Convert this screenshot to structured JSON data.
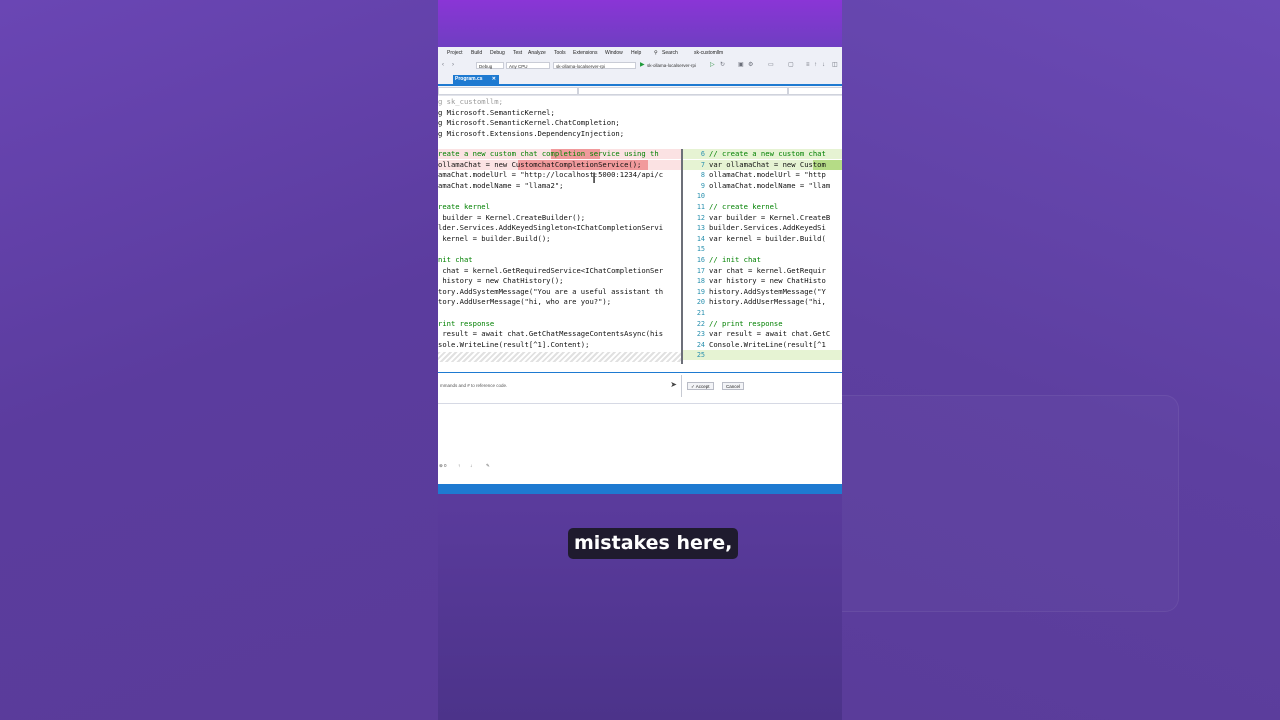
{
  "menu": [
    "Project",
    "Build",
    "Debug",
    "Test",
    "Analyze",
    "Tools",
    "Extensions",
    "Window",
    "Help"
  ],
  "search_label": "Search",
  "solution_name": "sk-customllm",
  "toolbar": {
    "config": "Debug",
    "platform": "Any CPU",
    "project": "sk-ollama-localserver-rpi",
    "run_target": "sk-ollama-localserver-rpi"
  },
  "tab": {
    "label": "Program.cs",
    "close": "✕"
  },
  "code_top": [
    "g sk_customllm;",
    "g Microsoft.SemanticKernel;",
    "g Microsoft.SemanticKernel.ChatCompletion;",
    "g Microsoft.Extensions.DependencyInjection;"
  ],
  "left_lines": [
    "reate a new custom chat completion service using th",
    "ollamaChat = new CustomchatCompletionService();",
    "amaChat.modelUrl = \"http://localhost:5000:1234/api/c",
    "amaChat.modelName = \"llama2\";",
    "",
    "reate kernel",
    " builder = Kernel.CreateBuilder();",
    "lder.Services.AddKeyedSingleton<IChatCompletionServi",
    " kernel = builder.Build();",
    "",
    "nit chat",
    " chat = kernel.GetRequiredService<IChatCompletionSer",
    " history = new ChatHistory();",
    "tory.AddSystemMessage(\"You are a useful assistant th",
    "tory.AddUserMessage(\"hi, who are you?\");",
    "",
    "rint response",
    " result = await chat.GetChatMessageContentsAsync(his",
    "sole.WriteLine(result[^1].Content);"
  ],
  "right_lines": [
    {
      "n": "6",
      "t": "// create a new custom chat"
    },
    {
      "n": "7",
      "t": "var ollamaChat = new Custom"
    },
    {
      "n": "8",
      "t": "ollamaChat.modelUrl = \"http"
    },
    {
      "n": "9",
      "t": "ollamaChat.modelName = \"llam"
    },
    {
      "n": "10",
      "t": ""
    },
    {
      "n": "11",
      "t": "// create kernel"
    },
    {
      "n": "12",
      "t": "var builder = Kernel.CreateB"
    },
    {
      "n": "13",
      "t": "builder.Services.AddKeyedSi"
    },
    {
      "n": "14",
      "t": "var kernel = builder.Build("
    },
    {
      "n": "15",
      "t": ""
    },
    {
      "n": "16",
      "t": "// init chat"
    },
    {
      "n": "17",
      "t": "var chat = kernel.GetRequir"
    },
    {
      "n": "18",
      "t": "var history = new ChatHisto"
    },
    {
      "n": "19",
      "t": "history.AddSystemMessage(\"Y"
    },
    {
      "n": "20",
      "t": "history.AddUserMessage(\"hi,"
    },
    {
      "n": "21",
      "t": ""
    },
    {
      "n": "22",
      "t": "// print response"
    },
    {
      "n": "23",
      "t": "var result = await chat.GetC"
    },
    {
      "n": "24",
      "t": "Console.WriteLine(result[^1"
    },
    {
      "n": "25",
      "t": ""
    }
  ],
  "chat": {
    "placeholder": "mmands and # to reference code.",
    "send_icon": "➤",
    "accept_label": "Accept",
    "cancel_label": "Cancel"
  },
  "caption": "mistakes here,",
  "colors": {
    "accent": "#1e7ad1",
    "deleted_line": "#fbe2e3",
    "added_line": "#e6f3d3"
  }
}
